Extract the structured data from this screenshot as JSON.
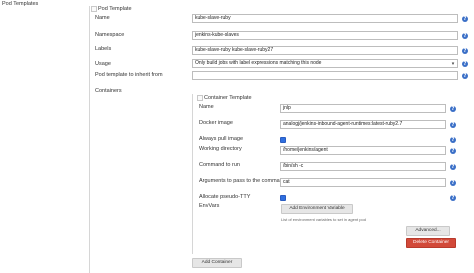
{
  "section": {
    "title": "Pod Templates"
  },
  "pod": {
    "header": "Pod Template",
    "name": {
      "label": "Name",
      "value": "kube-slave-ruby"
    },
    "namespace": {
      "label": "Namespace",
      "value": "jenkins-kube-slaves"
    },
    "labels": {
      "label": "Labels",
      "value": "kube-slave-ruby kube-slave-ruby27"
    },
    "usage": {
      "label": "Usage",
      "value": "Only build jobs with label expressions matching this node"
    },
    "inherit": {
      "label": "Pod template to inherit from",
      "value": ""
    },
    "containers_label": "Containers"
  },
  "container": {
    "header": "Container Template",
    "name": {
      "label": "Name",
      "value": "jnlp"
    },
    "image": {
      "label": "Docker image",
      "value": "analogj/jenkins-inbound-agent-runtimes:latest-ruby2.7"
    },
    "always_pull": {
      "label": "Always pull image",
      "checked": true
    },
    "workdir": {
      "label": "Working directory",
      "value": "/home/jenkins/agent"
    },
    "command": {
      "label": "Command to run",
      "value": "/bin/sh -c"
    },
    "args": {
      "label": "Arguments to pass to the command",
      "value": "cat"
    },
    "tty": {
      "label": "Allocate pseudo-TTY",
      "checked": true
    },
    "envvars": {
      "label": "EnvVars",
      "add_button": "Add Environment Variable",
      "hint": "List of environment variables to set in agent pod"
    },
    "advanced_button": "Advanced...",
    "delete_button": "Delete Container"
  },
  "add_container_button": "Add Container",
  "icons": {
    "help": "help-icon",
    "dropdown": "chevron-down-icon",
    "checkbox": "checkbox-checked-icon",
    "drag": "drag-handle-icon"
  },
  "colors": {
    "help": "#3a6fc7",
    "delete": "#d24939",
    "checkbox": "#2f6fe0"
  }
}
